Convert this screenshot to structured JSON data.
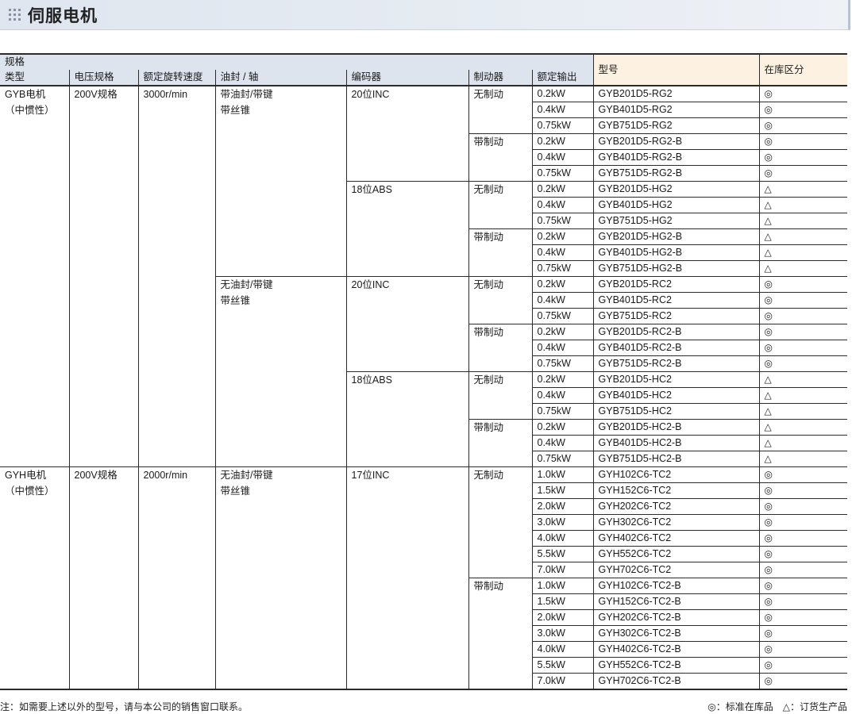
{
  "page": {
    "title": "伺服电机"
  },
  "table": {
    "header": {
      "spec_group": "规格",
      "type": "类型",
      "voltage": "电压规格",
      "speed": "额定旋转速度",
      "seal_shaft": "油封 / 轴",
      "encoder": "编码器",
      "brake": "制动器",
      "output": "额定输出",
      "model": "型号",
      "stock": "在库区分"
    },
    "groups": [
      {
        "type": "GYB电机",
        "type_sub": "（中惯性）",
        "voltage": "200V规格",
        "speed": "3000r/min",
        "seals": [
          {
            "seal": "带油封/带键",
            "seal_sub": "带丝锥",
            "encoders": [
              {
                "encoder": "20位INC",
                "brakes": [
                  {
                    "brake": "无制动",
                    "rows": [
                      {
                        "output": "0.2kW",
                        "model": "GYB201D5-RG2",
                        "stock": "◎"
                      },
                      {
                        "output": "0.4kW",
                        "model": "GYB401D5-RG2",
                        "stock": "◎"
                      },
                      {
                        "output": "0.75kW",
                        "model": "GYB751D5-RG2",
                        "stock": "◎"
                      }
                    ]
                  },
                  {
                    "brake": "带制动",
                    "rows": [
                      {
                        "output": "0.2kW",
                        "model": "GYB201D5-RG2-B",
                        "stock": "◎"
                      },
                      {
                        "output": "0.4kW",
                        "model": "GYB401D5-RG2-B",
                        "stock": "◎"
                      },
                      {
                        "output": "0.75kW",
                        "model": "GYB751D5-RG2-B",
                        "stock": "◎"
                      }
                    ]
                  }
                ]
              },
              {
                "encoder": "18位ABS",
                "brakes": [
                  {
                    "brake": "无制动",
                    "rows": [
                      {
                        "output": "0.2kW",
                        "model": "GYB201D5-HG2",
                        "stock": "△"
                      },
                      {
                        "output": "0.4kW",
                        "model": "GYB401D5-HG2",
                        "stock": "△"
                      },
                      {
                        "output": "0.75kW",
                        "model": "GYB751D5-HG2",
                        "stock": "△"
                      }
                    ]
                  },
                  {
                    "brake": "带制动",
                    "rows": [
                      {
                        "output": "0.2kW",
                        "model": "GYB201D5-HG2-B",
                        "stock": "△"
                      },
                      {
                        "output": "0.4kW",
                        "model": "GYB401D5-HG2-B",
                        "stock": "△"
                      },
                      {
                        "output": "0.75kW",
                        "model": "GYB751D5-HG2-B",
                        "stock": "△"
                      }
                    ]
                  }
                ]
              }
            ]
          },
          {
            "seal": "无油封/带键",
            "seal_sub": "带丝锥",
            "encoders": [
              {
                "encoder": "20位INC",
                "brakes": [
                  {
                    "brake": "无制动",
                    "rows": [
                      {
                        "output": "0.2kW",
                        "model": "GYB201D5-RC2",
                        "stock": "◎"
                      },
                      {
                        "output": "0.4kW",
                        "model": "GYB401D5-RC2",
                        "stock": "◎"
                      },
                      {
                        "output": "0.75kW",
                        "model": "GYB751D5-RC2",
                        "stock": "◎"
                      }
                    ]
                  },
                  {
                    "brake": "带制动",
                    "rows": [
                      {
                        "output": "0.2kW",
                        "model": "GYB201D5-RC2-B",
                        "stock": "◎"
                      },
                      {
                        "output": "0.4kW",
                        "model": "GYB401D5-RC2-B",
                        "stock": "◎"
                      },
                      {
                        "output": "0.75kW",
                        "model": "GYB751D5-RC2-B",
                        "stock": "◎"
                      }
                    ]
                  }
                ]
              },
              {
                "encoder": "18位ABS",
                "brakes": [
                  {
                    "brake": "无制动",
                    "rows": [
                      {
                        "output": "0.2kW",
                        "model": "GYB201D5-HC2",
                        "stock": "△"
                      },
                      {
                        "output": "0.4kW",
                        "model": "GYB401D5-HC2",
                        "stock": "△"
                      },
                      {
                        "output": "0.75kW",
                        "model": "GYB751D5-HC2",
                        "stock": "△"
                      }
                    ]
                  },
                  {
                    "brake": "带制动",
                    "rows": [
                      {
                        "output": "0.2kW",
                        "model": "GYB201D5-HC2-B",
                        "stock": "△"
                      },
                      {
                        "output": "0.4kW",
                        "model": "GYB401D5-HC2-B",
                        "stock": "△"
                      },
                      {
                        "output": "0.75kW",
                        "model": "GYB751D5-HC2-B",
                        "stock": "△"
                      }
                    ]
                  }
                ]
              }
            ]
          }
        ]
      },
      {
        "type": "GYH电机",
        "type_sub": "（中惯性）",
        "voltage": "200V规格",
        "speed": "2000r/min",
        "seals": [
          {
            "seal": "无油封/带键",
            "seal_sub": "带丝锥",
            "encoders": [
              {
                "encoder": "17位INC",
                "brakes": [
                  {
                    "brake": "无制动",
                    "rows": [
                      {
                        "output": "1.0kW",
                        "model": "GYH102C6-TC2",
                        "stock": "◎"
                      },
                      {
                        "output": "1.5kW",
                        "model": "GYH152C6-TC2",
                        "stock": "◎"
                      },
                      {
                        "output": "2.0kW",
                        "model": "GYH202C6-TC2",
                        "stock": "◎"
                      },
                      {
                        "output": "3.0kW",
                        "model": "GYH302C6-TC2",
                        "stock": "◎"
                      },
                      {
                        "output": "4.0kW",
                        "model": "GYH402C6-TC2",
                        "stock": "◎"
                      },
                      {
                        "output": "5.5kW",
                        "model": "GYH552C6-TC2",
                        "stock": "◎"
                      },
                      {
                        "output": "7.0kW",
                        "model": "GYH702C6-TC2",
                        "stock": "◎"
                      }
                    ]
                  },
                  {
                    "brake": "带制动",
                    "rows": [
                      {
                        "output": "1.0kW",
                        "model": "GYH102C6-TC2-B",
                        "stock": "◎"
                      },
                      {
                        "output": "1.5kW",
                        "model": "GYH152C6-TC2-B",
                        "stock": "◎"
                      },
                      {
                        "output": "2.0kW",
                        "model": "GYH202C6-TC2-B",
                        "stock": "◎"
                      },
                      {
                        "output": "3.0kW",
                        "model": "GYH302C6-TC2-B",
                        "stock": "◎"
                      },
                      {
                        "output": "4.0kW",
                        "model": "GYH402C6-TC2-B",
                        "stock": "◎"
                      },
                      {
                        "output": "5.5kW",
                        "model": "GYH552C6-TC2-B",
                        "stock": "◎"
                      },
                      {
                        "output": "7.0kW",
                        "model": "GYH702C6-TC2-B",
                        "stock": "◎"
                      }
                    ]
                  }
                ]
              }
            ]
          }
        ]
      }
    ]
  },
  "footer": {
    "note": "注：如需要上述以外的型号，请与本公司的销售窗口联系。",
    "legend": "◎：标准在库品　△：订货生产品"
  },
  "icons": {
    "title_icon": "dot-grid-icon"
  }
}
